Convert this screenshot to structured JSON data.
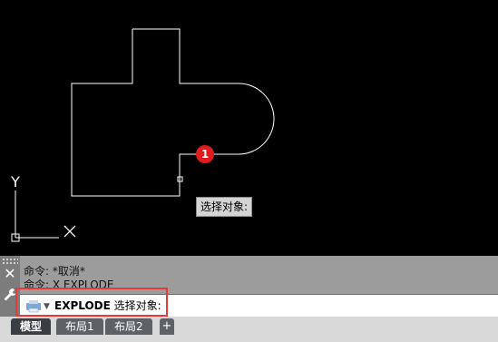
{
  "canvas": {
    "ucs_axis_label": "Y",
    "tooltip_text": "选择对象:",
    "callout_number": "1"
  },
  "command_panel": {
    "history": [
      "命令: *取消*",
      "命令: X EXPLODE"
    ],
    "input_command": "EXPLODE",
    "input_prompt": "选择对象:"
  },
  "tabs": {
    "items": [
      "模型",
      "布局1",
      "布局2"
    ],
    "add_label": "+"
  },
  "colors": {
    "canvas_bg": "#000000",
    "geometry": "#ffffff",
    "highlight": "#e33b3b",
    "callout": "#e01c1c"
  }
}
